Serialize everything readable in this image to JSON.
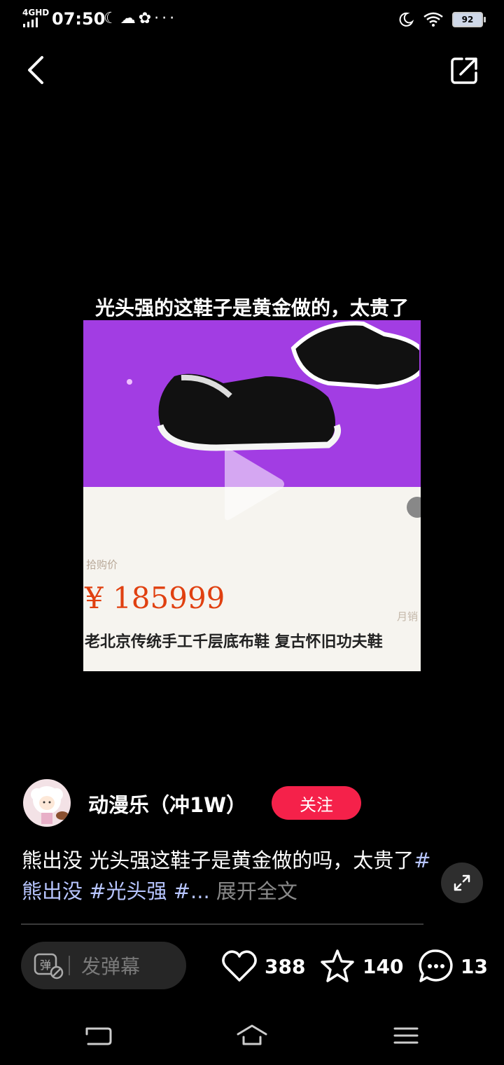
{
  "status_bar": {
    "network": "4GHD",
    "time": "07:50",
    "left_icons": [
      "moon-icon",
      "cloud-moon-icon",
      "wechat-icon",
      "more-dots-icon"
    ],
    "more_dots": "···",
    "battery": "92"
  },
  "video": {
    "caption": "光头强的这鞋子是黄金做的，太贵了",
    "price_label": "拾购价",
    "price": "¥ 185999",
    "monthly_label": "月销",
    "product_title": "老北京传统手工千层底布鞋  复古怀旧功夫鞋",
    "colors": {
      "top_bg": "#a23de3",
      "bottom_bg": "#f6f4ef",
      "price": "#e04010"
    }
  },
  "author": {
    "name": "动漫乐（冲1W）",
    "follow_label": "关注"
  },
  "description": {
    "text": "熊出没 光头强这鞋子是黄金做的吗，太贵了",
    "tags": "#熊出没 #光头强 #...",
    "more": " 展开全文"
  },
  "actions": {
    "danmaku_placeholder": "发弹幕",
    "likes": "388",
    "favorites": "140",
    "comments": "13"
  },
  "colors": {
    "follow": "#f5214a",
    "tag": "#b7c5ff"
  }
}
